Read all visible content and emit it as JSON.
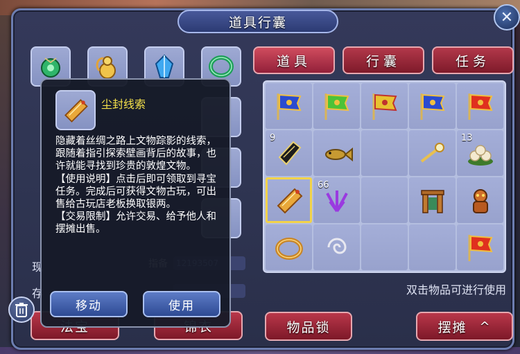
{
  "window": {
    "title": "道具行囊",
    "close_symbol": "✕"
  },
  "tabs": [
    {
      "label": "道具",
      "active": true
    },
    {
      "label": "行囊",
      "active": false
    },
    {
      "label": "任务",
      "active": false
    }
  ],
  "inventory": {
    "cells": [
      {
        "item": "blue-banner-icon",
        "count": ""
      },
      {
        "item": "green-banner-icon",
        "count": ""
      },
      {
        "item": "yellow-banner-icon",
        "count": ""
      },
      {
        "item": "blue-banner-icon",
        "count": ""
      },
      {
        "item": "red-banner-icon",
        "count": ""
      },
      {
        "item": "scroll-icon",
        "count": "9"
      },
      {
        "item": "fish-icon",
        "count": ""
      },
      {
        "item": "",
        "count": ""
      },
      {
        "item": "wand-icon",
        "count": ""
      },
      {
        "item": "buns-icon",
        "count": "13"
      },
      {
        "item": "dusty-clue-icon",
        "count": "",
        "selected": true
      },
      {
        "item": "purple-herb-icon",
        "count": "66"
      },
      {
        "item": "",
        "count": ""
      },
      {
        "item": "gate-icon",
        "count": ""
      },
      {
        "item": "beast-icon",
        "count": ""
      },
      {
        "item": "ring-icon",
        "count": ""
      },
      {
        "item": "silver-swirl-icon",
        "count": ""
      },
      {
        "item": "",
        "count": ""
      },
      {
        "item": "",
        "count": ""
      },
      {
        "item": "red-banner-icon",
        "count": ""
      }
    ],
    "hint": "双击物品可进行使用"
  },
  "buttons": {
    "lock": "物品锁",
    "stall": "摆摊",
    "stall_caret": "^",
    "left1": "法宝",
    "left2": "锦衣"
  },
  "background": {
    "label1": "现",
    "label2": "存",
    "field_value": "12193507",
    "field_label": "指备"
  },
  "tooltip": {
    "name": "尘封线索",
    "description": "隐藏着丝绸之路上文物踪影的线索，跟随着指引探索壁画背后的故事，也许就能寻找到珍贵的敦煌文物。\n【使用说明】点击后即可领取到寻宝任务。完成后可获得文物古玩，可出售给古玩店老板换取银两。\n【交易限制】允许交易、给予他人和摆摊出售。",
    "move_label": "移动",
    "use_label": "使用"
  },
  "colors": {
    "tab_red": "#b2384a",
    "tooltip_name": "#f5e14a",
    "selection": "#f2d34a"
  }
}
